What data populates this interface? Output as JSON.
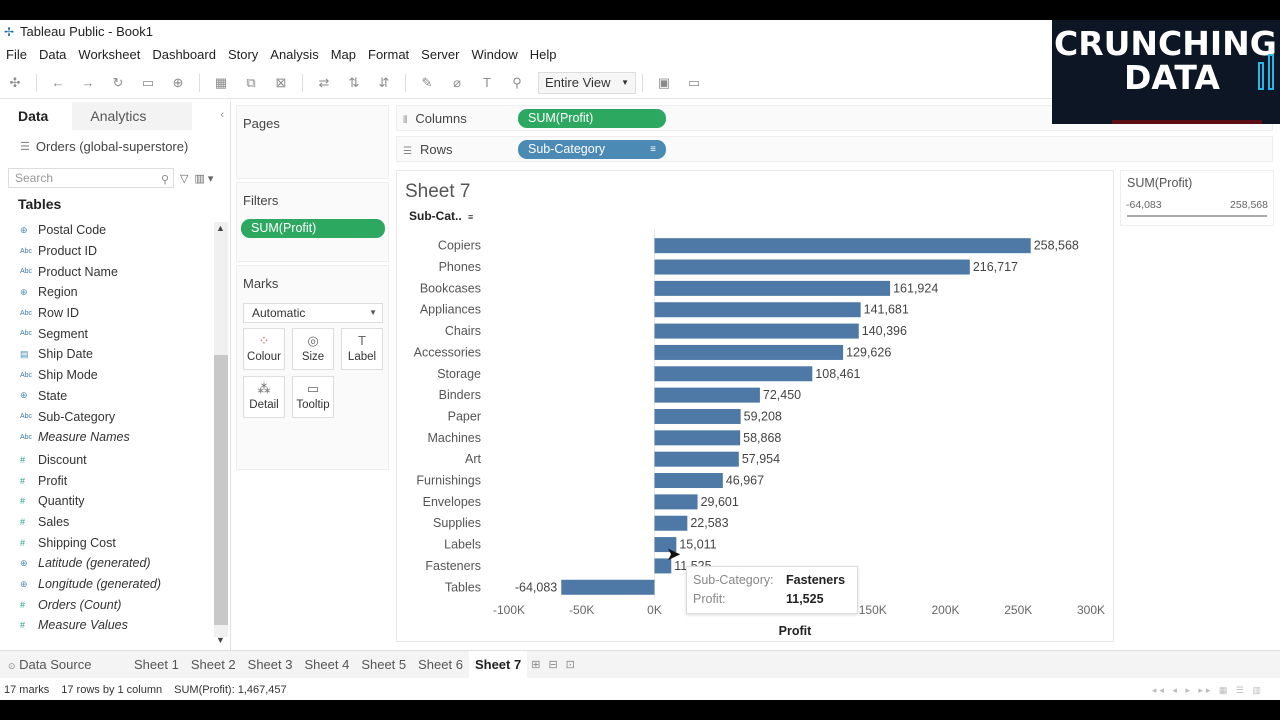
{
  "window": {
    "title": "Tableau Public - Book1"
  },
  "menu": [
    "File",
    "Data",
    "Worksheet",
    "Dashboard",
    "Story",
    "Analysis",
    "Map",
    "Format",
    "Server",
    "Window",
    "Help"
  ],
  "toolbar": {
    "view_mode": "Entire View"
  },
  "left_panel": {
    "tab_data": "Data",
    "tab_analytics": "Analytics",
    "datasource": "Orders (global-superstore)",
    "search_placeholder": "Search",
    "tables_heading": "Tables",
    "dimensions": [
      {
        "name": "Postal Code",
        "icon": "globe"
      },
      {
        "name": "Product ID",
        "icon": "abc"
      },
      {
        "name": "Product Name",
        "icon": "abc"
      },
      {
        "name": "Region",
        "icon": "globe"
      },
      {
        "name": "Row ID",
        "icon": "abc"
      },
      {
        "name": "Segment",
        "icon": "abc"
      },
      {
        "name": "Ship Date",
        "icon": "calendar"
      },
      {
        "name": "Ship Mode",
        "icon": "abc"
      },
      {
        "name": "State",
        "icon": "globe"
      },
      {
        "name": "Sub-Category",
        "icon": "abc"
      },
      {
        "name": "Measure Names",
        "icon": "abc",
        "italic": true
      }
    ],
    "measures": [
      {
        "name": "Discount",
        "icon": "hash"
      },
      {
        "name": "Profit",
        "icon": "hash"
      },
      {
        "name": "Quantity",
        "icon": "hash"
      },
      {
        "name": "Sales",
        "icon": "hash"
      },
      {
        "name": "Shipping Cost",
        "icon": "hash"
      },
      {
        "name": "Latitude (generated)",
        "icon": "globe",
        "italic": true
      },
      {
        "name": "Longitude (generated)",
        "icon": "globe",
        "italic": true
      },
      {
        "name": "Orders (Count)",
        "icon": "hash",
        "italic": true
      },
      {
        "name": "Measure Values",
        "icon": "hash",
        "italic": true
      }
    ]
  },
  "cards": {
    "pages": "Pages",
    "filters": "Filters",
    "filter_pill": "SUM(Profit)",
    "marks": "Marks",
    "mark_type": "Automatic",
    "mark_buttons": [
      "Colour",
      "Size",
      "Label",
      "Detail",
      "Tooltip"
    ]
  },
  "shelves": {
    "columns_label": "Columns",
    "columns_pill": "SUM(Profit)",
    "rows_label": "Rows",
    "rows_pill": "Sub-Category"
  },
  "sheet": {
    "title": "Sheet 7",
    "row_header": "Sub-Cat..",
    "axis_title": "Profit"
  },
  "legend": {
    "title": "SUM(Profit)",
    "min": "-64,083",
    "max": "258,568"
  },
  "tooltip": {
    "key1": "Sub-Category:",
    "val1": "Fasteners",
    "key2": "Profit:",
    "val2": "11,525"
  },
  "tabs": {
    "datasource": "Data Source",
    "sheets": [
      "Sheet 1",
      "Sheet 2",
      "Sheet 3",
      "Sheet 4",
      "Sheet 5",
      "Sheet 6",
      "Sheet 7"
    ],
    "active": "Sheet 7"
  },
  "status": {
    "marks": "17 marks",
    "rows": "17 rows by 1 column",
    "sum": "SUM(Profit): 1,467,457"
  },
  "brand": {
    "line1": "CRUNCHING",
    "line2": "DATA"
  },
  "colors": {
    "bar": "#4e79a7",
    "pill_measure": "#2ca860",
    "pill_dimension": "#4b8ab5"
  },
  "chart_data": {
    "type": "bar",
    "orientation": "horizontal",
    "categories": [
      "Copiers",
      "Phones",
      "Bookcases",
      "Appliances",
      "Chairs",
      "Accessories",
      "Storage",
      "Binders",
      "Paper",
      "Machines",
      "Art",
      "Furnishings",
      "Envelopes",
      "Supplies",
      "Labels",
      "Fasteners",
      "Tables"
    ],
    "values": [
      258568,
      216717,
      161924,
      141681,
      140396,
      129626,
      108461,
      72450,
      59208,
      58868,
      57954,
      46967,
      29601,
      22583,
      15011,
      11525,
      -64083
    ],
    "labels": [
      "258,568",
      "216,717",
      "161,924",
      "141,681",
      "140,396",
      "129,626",
      "108,461",
      "72,450",
      "59,208",
      "58,868",
      "57,954",
      "46,967",
      "29,601",
      "22,583",
      "15,011",
      "11,525",
      "-64,083"
    ],
    "xticks": [
      "-100K",
      "-50K",
      "0K",
      "50K",
      "100K",
      "150K",
      "200K",
      "250K",
      "300K"
    ],
    "xtick_values": [
      -100000,
      -50000,
      0,
      50000,
      100000,
      150000,
      200000,
      250000,
      300000
    ],
    "xlim": [
      -100000,
      300000
    ],
    "xlabel": "Profit",
    "sorted": "descending"
  }
}
